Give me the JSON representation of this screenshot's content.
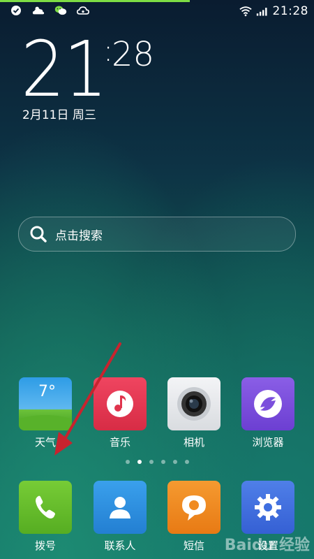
{
  "status_bar": {
    "time": "21:28",
    "left_icons": [
      "check-circle-icon",
      "weather-cloud-icon",
      "wechat-icon",
      "cloud-sync-icon"
    ],
    "right_icons": [
      "wifi-icon",
      "signal-icon"
    ]
  },
  "lockscreen": {
    "clock_hour": "21",
    "clock_colon": ":",
    "clock_minute": "28",
    "date": "2月11日 周三"
  },
  "search": {
    "placeholder": "点击搜索"
  },
  "apps_row": [
    {
      "label": "天气",
      "icon": "weather-icon",
      "temp": "7°",
      "color": "#3aa7e8"
    },
    {
      "label": "音乐",
      "icon": "music-icon",
      "color": "#e0344d"
    },
    {
      "label": "相机",
      "icon": "camera-icon",
      "color": "#e9ebee"
    },
    {
      "label": "浏览器",
      "icon": "browser-icon",
      "color": "#7b4fdc"
    }
  ],
  "page_indicator": {
    "count": 6,
    "active": 1
  },
  "dock": [
    {
      "label": "拨号",
      "icon": "phone-icon",
      "color": "#65bf2b"
    },
    {
      "label": "联系人",
      "icon": "contacts-icon",
      "color": "#2e8fe0"
    },
    {
      "label": "短信",
      "icon": "message-icon",
      "color": "#f08b22"
    },
    {
      "label": "设置",
      "icon": "settings-icon",
      "color": "#3f6fe0"
    }
  ],
  "watermark": "Baidu 经验"
}
